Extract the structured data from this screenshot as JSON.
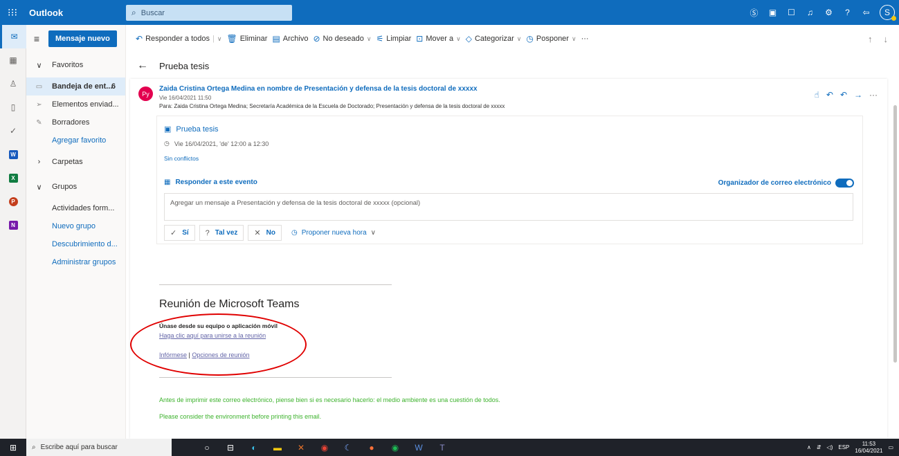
{
  "app": {
    "name": "Outlook",
    "search_placeholder": "Buscar",
    "accent": "#0f6cbd",
    "user_initial": "S"
  },
  "folders": {
    "new_mail": "Mensaje nuevo",
    "favorites_label": "Favoritos",
    "inbox_label": "Bandeja de ent...",
    "inbox_count": "6",
    "sent_label": "Elementos enviad...",
    "drafts_label": "Borradores",
    "add_favorite": "Agregar favorito",
    "folders_label": "Carpetas",
    "groups_label": "Grupos",
    "groups": [
      "Actividades form...",
      "Nuevo grupo",
      "Descubrimiento d...",
      "Administrar grupos"
    ]
  },
  "toolbar": {
    "reply_all": "Responder a todos",
    "delete": "Eliminar",
    "archive": "Archivo",
    "junk": "No deseado",
    "sweep": "Limpiar",
    "move": "Mover a",
    "categorize": "Categorizar",
    "snooze": "Posponer",
    "more": "···"
  },
  "message": {
    "subject": "Prueba tesis",
    "sender_initials": "Py",
    "sender": "Zaida Cristina Ortega Medina en nombre de Presentación y defensa de la tesis doctoral de xxxxx",
    "date": "Vie 16/04/2021 11:50",
    "to": "Para: Zaida Cristina Ortega Medina; Secretaría Académica de la Escuela de Doctorado; Presentación y defensa de la tesis doctoral de xxxxx"
  },
  "event": {
    "title": "Prueba tesis",
    "time": "Vie 16/04/2021, 'de' 12:00 a 12:30",
    "conflicts": "Sin conflictos",
    "respond_label": "Responder a este evento",
    "organizer_label": "Organizador de correo electrónico",
    "organizer_toggle_on": true,
    "message_placeholder": "Agregar un mensaje a Presentación y defensa de la tesis doctoral de xxxxx (opcional)",
    "yes": "Sí",
    "maybe": "Tal vez",
    "no": "No",
    "propose": "Proponer nueva hora"
  },
  "teams": {
    "title": "Reunión de Microsoft Teams",
    "join_heading": "Únase desde su equipo o aplicación móvil",
    "join_link": "Haga clic aquí para unirse a la reunión",
    "learn_more": "Infórmese",
    "separator": "|",
    "options": "Opciones de reunión"
  },
  "footer": {
    "line1": "Antes de imprimir este correo electrónico, piense bien si es necesario hacerlo: el medio ambiente es una cuestión de todos.",
    "line2": "Please consider the environment before printing this email.",
    "color": "#3cb22c"
  },
  "taskbar": {
    "search_placeholder": "Escribe aquí para buscar",
    "language": "ESP",
    "time": "11:53",
    "date": "16/04/2021"
  }
}
